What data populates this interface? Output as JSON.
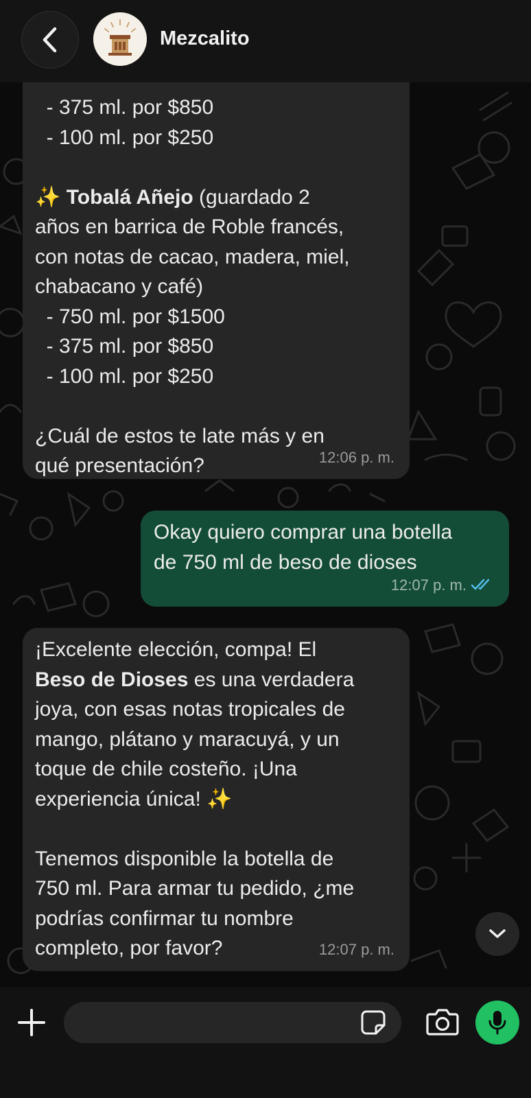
{
  "header": {
    "contact_name": "Mezcalito",
    "back_icon": "chevron-left-icon",
    "avatar_icon": "mezcal-logo"
  },
  "messages": [
    {
      "direction": "incoming",
      "lines": [
        {
          "text": "  - 375 ml. por $850"
        },
        {
          "text": "  - 100 ml. por $250"
        },
        {
          "text": ""
        },
        {
          "emoji": "✨",
          "bold": "Tobalá Añejo",
          "text": " (guardado 2"
        },
        {
          "text": "años en barrica de Roble francés,"
        },
        {
          "text": "con notas de cacao, madera, miel,"
        },
        {
          "text": "chabacano y café)"
        },
        {
          "text": "  - 750 ml. por $1500"
        },
        {
          "text": "  - 375 ml. por $850"
        },
        {
          "text": "  - 100 ml. por $250"
        },
        {
          "text": ""
        },
        {
          "text": "¿Cuál de estos te late más y en"
        },
        {
          "text": "qué presentación?"
        }
      ],
      "time": "12:06 p. m."
    },
    {
      "direction": "outgoing",
      "lines": [
        {
          "text": "Okay quiero comprar una botella"
        },
        {
          "text": "de 750 ml de beso de dioses"
        }
      ],
      "time": "12:07 p. m.",
      "status_icon": "double-check-icon",
      "status_color": "#53bdeb"
    },
    {
      "direction": "incoming",
      "lines": [
        {
          "text": "¡Excelente elección, compa! El"
        },
        {
          "bold": "Beso de Dioses",
          "text": " es una verdadera"
        },
        {
          "text": "joya, con esas notas tropicales de"
        },
        {
          "text": "mango, plátano y maracuyá, y un"
        },
        {
          "text": "toque de chile costeño. ¡Una"
        },
        {
          "text": "experiencia única! ",
          "emoji_after": "✨"
        },
        {
          "text": ""
        },
        {
          "text": "Tenemos disponible la botella de"
        },
        {
          "text": "750 ml. Para armar tu pedido, ¿me"
        },
        {
          "text": "podrías confirmar tu nombre"
        },
        {
          "text": "completo, por favor?"
        }
      ],
      "time": "12:07 p. m."
    }
  ],
  "composer": {
    "placeholder": "",
    "value": "",
    "plus_icon": "plus-icon",
    "sticker_icon": "sticker-icon",
    "camera_icon": "camera-icon",
    "mic_icon": "microphone-icon"
  },
  "scroll_down_icon": "chevron-down-icon",
  "colors": {
    "background": "#0b0b0b",
    "incoming_bubble": "#262626",
    "outgoing_bubble": "#144d37",
    "accent_green": "#21c063",
    "read_receipt": "#53bdeb"
  }
}
